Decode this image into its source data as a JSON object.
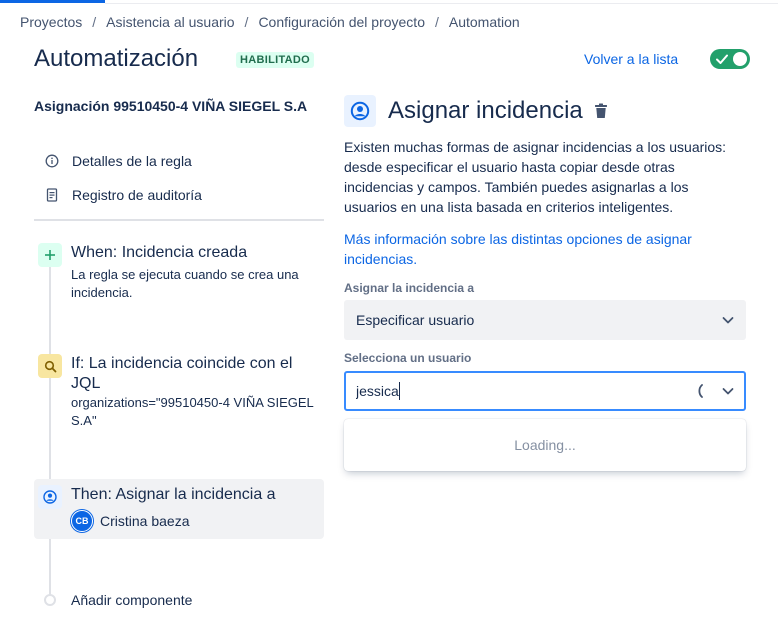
{
  "breadcrumb": {
    "items": [
      "Proyectos",
      "Asistencia al usuario",
      "Configuración del proyecto",
      "Automation"
    ],
    "separator": "/"
  },
  "header": {
    "title": "Automatización",
    "status_lozenge": "HABILITADO",
    "back_link": "Volver a la lista",
    "toggle_enabled": true
  },
  "sidebar": {
    "rule_name": "Asignación 99510450-4 VIÑA SIEGEL S.A",
    "links": [
      {
        "label": "Detalles de la regla",
        "icon": "info-icon"
      },
      {
        "label": "Registro de auditoría",
        "icon": "audit-log-icon"
      }
    ],
    "steps": [
      {
        "title": "When: Incidencia creada",
        "description": "La regla se ejecuta cuando se crea una incidencia.",
        "icon": "plus-icon",
        "color": "#dcfff1"
      },
      {
        "title": "If: La incidencia coincide con el JQL",
        "description": "organizations=\"99510450-4 VIÑA SIEGEL S.A\"",
        "icon": "search-icon",
        "color": "#f8e6a0"
      },
      {
        "title": "Then: Asignar la incidencia a",
        "assignee_initials": "CB",
        "assignee_name": "Cristina baeza",
        "icon": "user-circle-icon",
        "color": "#e9f2ff"
      }
    ],
    "add_component": "Añadir componente"
  },
  "detail": {
    "title": "Asignar incidencia",
    "description": "Existen muchas formas de asignar incidencias a los usuarios: desde especificar el usuario hasta copiar desde otras incidencias y campos. También puedes asignarlas a los usuarios en una lista basada en criterios inteligentes.",
    "more_link": "Más información sobre las distintas opciones de asignar incidencias.",
    "assign_label": "Asignar la incidencia a",
    "assign_value": "Especificar usuario",
    "user_label": "Selecciona un usuario",
    "user_input_value": "jessica",
    "loading_text": "Loading..."
  }
}
